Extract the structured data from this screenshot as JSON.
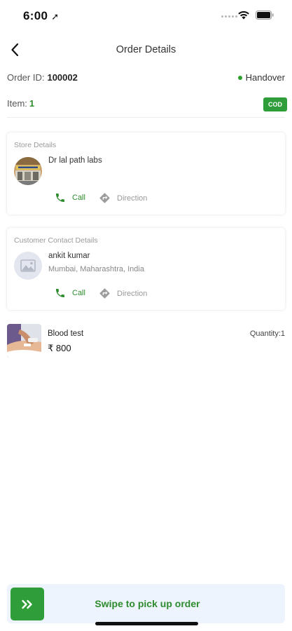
{
  "status_bar": {
    "time": "6:00",
    "nav_arrow": "➚"
  },
  "header": {
    "title": "Order Details",
    "back_icon": "chevron-left-icon"
  },
  "order": {
    "id_label": "Order ID:",
    "id_value": "100002",
    "status": "Handover",
    "status_color": "#2e9e2e",
    "item_label": "Item:",
    "item_count": "1",
    "payment_badge": "COD"
  },
  "store": {
    "section_title": "Store Details",
    "name": "Dr lal path labs",
    "call_label": "Call",
    "direction_label": "Direction"
  },
  "customer": {
    "section_title": "Customer Contact Details",
    "name": "ankit kumar",
    "location": "Mumbai, Maharashtra, India",
    "call_label": "Call",
    "direction_label": "Direction"
  },
  "product": {
    "name": "Blood test",
    "price": "₹ 800",
    "quantity": "Quantity:1"
  },
  "swipe": {
    "label": "Swipe to pick up order",
    "handle_icon": "double-chevron-right-icon"
  },
  "colors": {
    "accent_green": "#2f9e3a",
    "swipe_bg": "#eef4fd"
  }
}
